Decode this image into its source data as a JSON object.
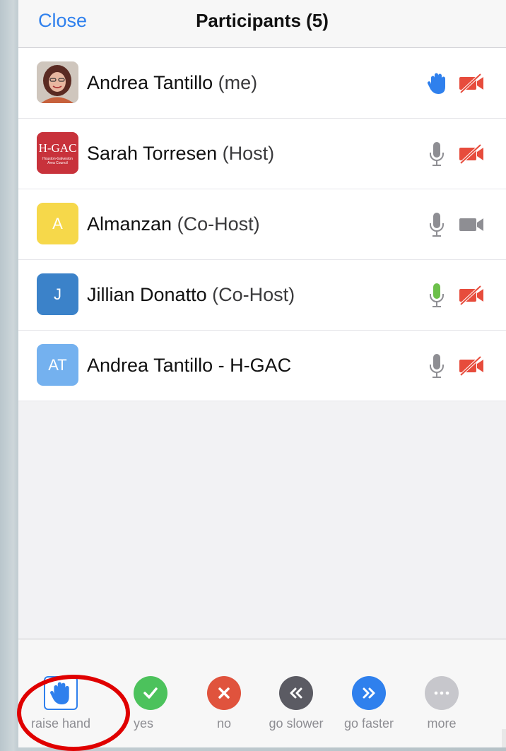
{
  "header": {
    "close_label": "Close",
    "title": "Participants (5)"
  },
  "participants": [
    {
      "name": "Andrea Tantillo",
      "role": "(me)",
      "avatar_type": "photo",
      "avatar_text": "",
      "avatar_color": "#c7613c",
      "mic": "raised-hand",
      "video": "off"
    },
    {
      "name": "Sarah Torresen",
      "role": "(Host)",
      "avatar_type": "logo",
      "avatar_text": "H-GAC",
      "avatar_color": "#c8323b",
      "logo_caption": "Houston-Galveston Area Council",
      "mic": "muted-gray",
      "video": "off"
    },
    {
      "name": "Almanzan",
      "role": "(Co-Host)",
      "avatar_type": "initial",
      "avatar_text": "A",
      "avatar_color": "#f6d84a",
      "mic": "muted-gray",
      "video": "on-gray"
    },
    {
      "name": "Jillian Donatto",
      "role": "(Co-Host)",
      "avatar_type": "initial",
      "avatar_text": "J",
      "avatar_color": "#3b82c9",
      "mic": "active-green",
      "video": "off"
    },
    {
      "name": "Andrea Tantillo - H-GAC",
      "role": "",
      "avatar_type": "initial",
      "avatar_text": "AT",
      "avatar_color": "#74b1ef",
      "mic": "muted-gray",
      "video": "off"
    }
  ],
  "toolbar": {
    "items": [
      {
        "label": "raise hand",
        "icon": "raise-hand-icon",
        "color": "#2f80ed"
      },
      {
        "label": "yes",
        "icon": "check-icon",
        "color": "#4cc25c"
      },
      {
        "label": "no",
        "icon": "x-icon",
        "color": "#e0533d"
      },
      {
        "label": "go slower",
        "icon": "rewind-icon",
        "color": "#5b5b63"
      },
      {
        "label": "go faster",
        "icon": "fast-forward-icon",
        "color": "#2f80ed"
      },
      {
        "label": "more",
        "icon": "ellipsis-icon",
        "color": "#c7c7cc"
      }
    ]
  },
  "colors": {
    "accent": "#2f80ed",
    "video_off": "#e74c3c",
    "mic_gray": "#8e8e93",
    "mic_active": "#6cc04a",
    "highlight_circle": "#e00000"
  }
}
